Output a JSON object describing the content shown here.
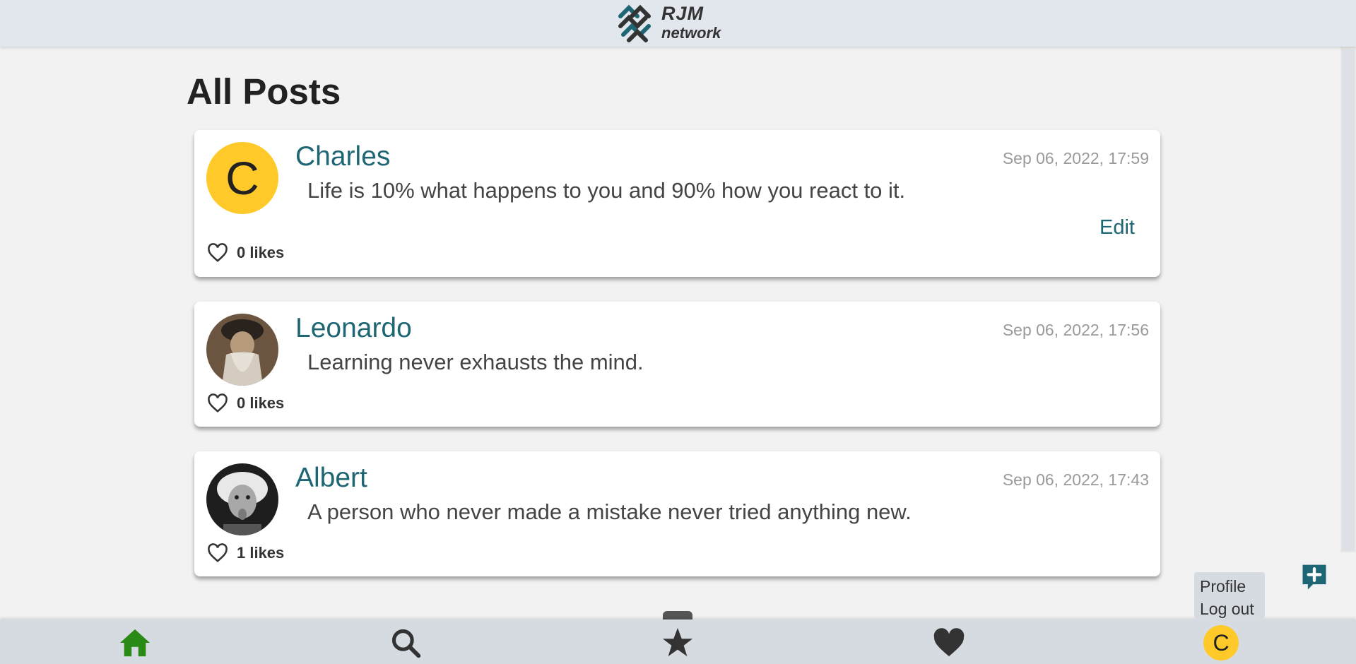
{
  "logo": {
    "line1": "RJM",
    "line2": "network"
  },
  "page_title": "All Posts",
  "posts": [
    {
      "author": "Charles",
      "time": "Sep 06, 2022, 17:59",
      "content": "Life is 10% what happens to you and 90% how you react to it.",
      "likes": "0 likes",
      "edit_label": "Edit",
      "avatar_letter": "C"
    },
    {
      "author": "Leonardo",
      "time": "Sep 06, 2022, 17:56",
      "content": "Learning never exhausts the mind.",
      "likes": "0 likes"
    },
    {
      "author": "Albert",
      "time": "Sep 06, 2022, 17:43",
      "content": "A person who never made a mistake never tried anything new.",
      "likes": "1 likes"
    }
  ],
  "user_menu": {
    "profile": "Profile",
    "logout": "Log out",
    "avatar_letter": "C"
  },
  "colors": {
    "accent": "#1e6674",
    "home_active": "#2a8a16",
    "avatar_yellow": "#ffc929"
  },
  "icons": {
    "nav": [
      "home-icon",
      "search-icon",
      "star-icon",
      "heart-icon"
    ],
    "post": "heart-outline-icon",
    "new_post": "add-comment-icon"
  }
}
